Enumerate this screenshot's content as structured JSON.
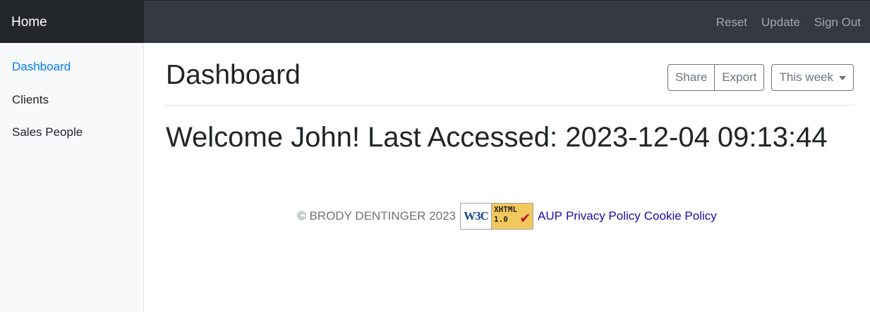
{
  "navbar": {
    "brand": "Home",
    "links": [
      "Reset",
      "Update",
      "Sign Out"
    ]
  },
  "sidebar": {
    "items": [
      {
        "label": "Dashboard",
        "active": true
      },
      {
        "label": "Clients",
        "active": false
      },
      {
        "label": "Sales People",
        "active": false
      }
    ]
  },
  "main": {
    "title": "Dashboard",
    "toolbar": {
      "share_label": "Share",
      "export_label": "Export",
      "range_label": "This week"
    },
    "welcome": "Welcome John! Last Accessed: 2023-12-04 09:13:44"
  },
  "footer": {
    "copyright": "© BRODY DENTINGER 2023",
    "badge": {
      "left": "W3C",
      "line1": "XHTML",
      "line2": "1.0"
    },
    "links": [
      "AUP",
      "Privacy Policy",
      "Cookie Policy"
    ]
  },
  "colors": {
    "navbar": "#343a40",
    "brand_bg": "#23272b",
    "active_link": "#007bff",
    "sidebar_bg": "#f8f9fa",
    "footer_link": "#1a0dab"
  }
}
